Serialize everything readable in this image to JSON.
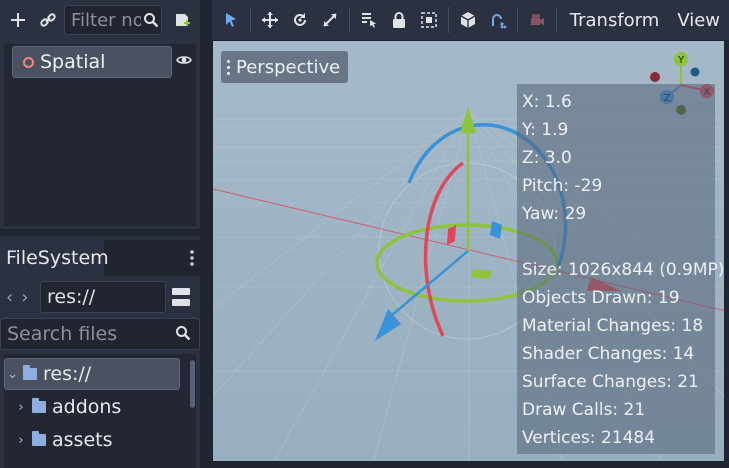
{
  "scene_dock": {
    "add_icon": "plus-icon",
    "link_icon": "link-icon",
    "filter": {
      "value": "Filter no",
      "placeholder": "Filter nodes"
    },
    "script_icon": "attach-script-icon",
    "root_node": {
      "label": "Spatial",
      "icon": "spatial-node-icon",
      "visibility_icon": "eye-icon"
    }
  },
  "filesystem_dock": {
    "tab_label": "FileSystem",
    "path": "res://",
    "search_placeholder": "Search files",
    "tree": [
      {
        "label": "res://",
        "expanded": true,
        "selected": true
      },
      {
        "label": "addons",
        "expanded": false
      },
      {
        "label": "assets",
        "expanded": false
      }
    ]
  },
  "viewport_toolbar": {
    "tools": [
      "select-icon",
      "move-icon",
      "rotate-icon",
      "scale-icon",
      "list-select-icon",
      "lock-icon",
      "group-icon",
      "local-space-icon",
      "snap-icon",
      "camera-icon"
    ],
    "menus": {
      "transform": "Transform",
      "view": "View"
    }
  },
  "viewport": {
    "perspective_label": "Perspective",
    "axes": {
      "x": "X",
      "y": "Y",
      "z": "Z"
    },
    "stats": {
      "x": "X: 1.6",
      "y": "Y: 1.9",
      "z": "Z: 3.0",
      "pitch": "Pitch: -29",
      "yaw": "Yaw: 29",
      "size": "Size: 1026x844 (0.9MP)",
      "objects_drawn": "Objects Drawn: 19",
      "material_changes": "Material Changes: 18",
      "shader_changes": "Shader Changes: 14",
      "surface_changes": "Surface Changes: 21",
      "draw_calls": "Draw Calls: 21",
      "vertices": "Vertices: 21484"
    }
  },
  "colors": {
    "x_axis": "#e0475a",
    "y_axis": "#8dc43c",
    "z_axis": "#3a93d8",
    "accent": "#4a90e2"
  }
}
